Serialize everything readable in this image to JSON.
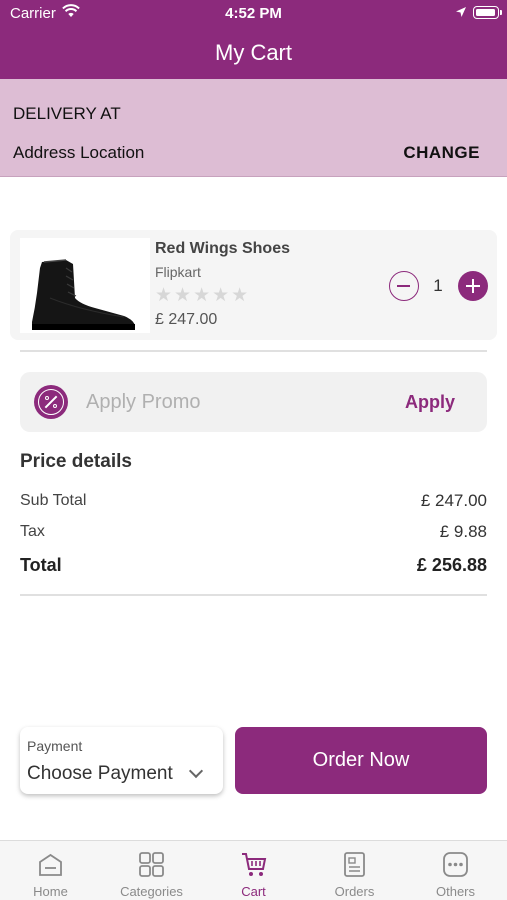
{
  "status_bar": {
    "carrier": "Carrier",
    "time": "4:52 PM"
  },
  "header": {
    "title": "My Cart"
  },
  "delivery": {
    "label": "DELIVERY AT",
    "address": "Address Location",
    "change_label": "CHANGE"
  },
  "cart_item": {
    "name": "Red Wings Shoes",
    "seller": "Flipkart",
    "rating": 0,
    "rating_max": 5,
    "stars": "★★★★★",
    "price": "£ 247.00",
    "quantity": "1"
  },
  "promo": {
    "placeholder": "Apply Promo",
    "apply_label": "Apply"
  },
  "price_details": {
    "heading": "Price details",
    "rows": [
      {
        "label": "Sub Total",
        "value": "£ 247.00"
      },
      {
        "label": "Tax",
        "value": "£ 9.88"
      },
      {
        "label": "Total",
        "value": "£ 256.88"
      }
    ]
  },
  "payment": {
    "label": "Payment",
    "value": "Choose Payment"
  },
  "order_button": {
    "label": "Order Now"
  },
  "tabs": [
    {
      "label": "Home",
      "icon": "home-icon",
      "active": false
    },
    {
      "label": "Categories",
      "icon": "grid-icon",
      "active": false
    },
    {
      "label": "Cart",
      "icon": "cart-icon",
      "active": true
    },
    {
      "label": "Orders",
      "icon": "orders-icon",
      "active": false
    },
    {
      "label": "Others",
      "icon": "more-icon",
      "active": false
    }
  ],
  "colors": {
    "primary": "#8c2a7c",
    "delivery_bg": "#ddbdd4",
    "tab_inactive": "#8a8a8a"
  }
}
